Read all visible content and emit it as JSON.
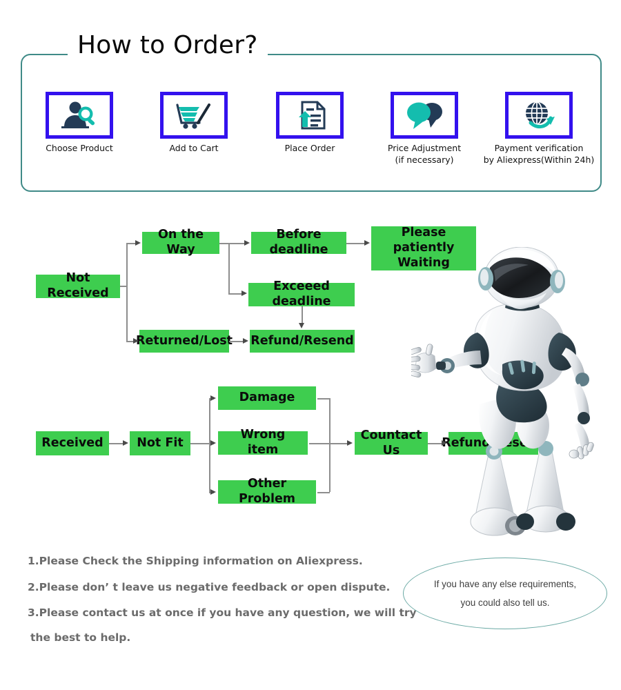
{
  "order_section": {
    "title": "How to Order?",
    "steps": [
      {
        "icon": "person-search-icon",
        "label_lines": [
          "Choose  Product"
        ]
      },
      {
        "icon": "shopping-cart-icon",
        "label_lines": [
          "Add to Cart"
        ]
      },
      {
        "icon": "document-upload-icon",
        "label_lines": [
          "Place  Order"
        ]
      },
      {
        "icon": "speech-bubbles-icon",
        "label_lines": [
          "Price Adjustment",
          "(if necessary)"
        ]
      },
      {
        "icon": "globe-arrow-icon",
        "label_lines": [
          "Payment verification",
          "by Aliexpress(Within 24h)"
        ]
      }
    ]
  },
  "flow_not_received": {
    "root": "Not Received",
    "on_the_way": "On the Way",
    "before_deadline": "Before deadline",
    "please_wait": "Please patiently\nWaiting",
    "please_wait_line1": "Please patiently",
    "please_wait_line2": "Waiting",
    "exceed_deadline": "Exceeed deadline",
    "returned_lost": "Returned/Lost",
    "refund_resend": "Refund/Resend"
  },
  "flow_received": {
    "root": "Received",
    "not_fit": "Not Fit",
    "damage": "Damage",
    "wrong_item": "Wrong item",
    "other_problem": "Other Problem",
    "contact_us": "Countact Us",
    "refund_resend": "Refund/Resend"
  },
  "notes": {
    "item1": "1.Please Check the Shipping information on Aliexpress.",
    "item2": "2.Please don’ t leave us negative feedback or open dispute.",
    "item3": "3.Please contact us at once if you have any question, we will try",
    "item3_cont": "the best to help."
  },
  "bubble": {
    "line1": "If you have any else requirements,",
    "line2": "you could also tell us."
  },
  "colors": {
    "frame_teal": "#3f8a87",
    "icon_border_blue": "#3311ee",
    "flow_green": "#3ecd4f",
    "icon_teal": "#14bdae",
    "icon_navy": "#233b56",
    "note_gray": "#6b6b6b",
    "bubble_teal": "#6aa9a4",
    "connector_gray": "#8d8d8d"
  },
  "decor": {
    "robot": "robot-illustration"
  }
}
